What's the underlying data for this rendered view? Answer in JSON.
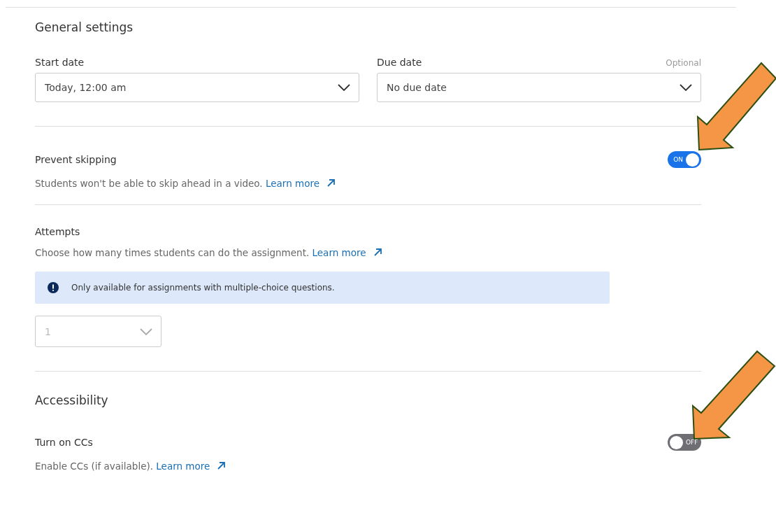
{
  "title": "General settings",
  "date_fields": [
    {
      "label": "Start date",
      "value": "Today, 12:00 am"
    },
    {
      "label": "Due date",
      "value": "No due date",
      "hint": "Optional"
    }
  ],
  "prevent_skipping": {
    "label": "Prevent skipping",
    "description": "Students won't be able to skip ahead in a video.",
    "link": "Learn more",
    "toggle": {
      "on": true,
      "text": "ON"
    }
  },
  "attempts": {
    "label": "Attempts",
    "description": "Choose how many times students can do the assignment.",
    "link": "Learn more",
    "notice": "Only available for assignments with multiple-choice questions.",
    "select": {
      "value": "1",
      "disabled": true
    }
  },
  "accessibility": {
    "title": "Accessibility",
    "label": "Turn on CCs",
    "description": "Enable CCs (if available).",
    "link": "Learn more",
    "toggle": {
      "on": false,
      "text": "OFF"
    }
  }
}
